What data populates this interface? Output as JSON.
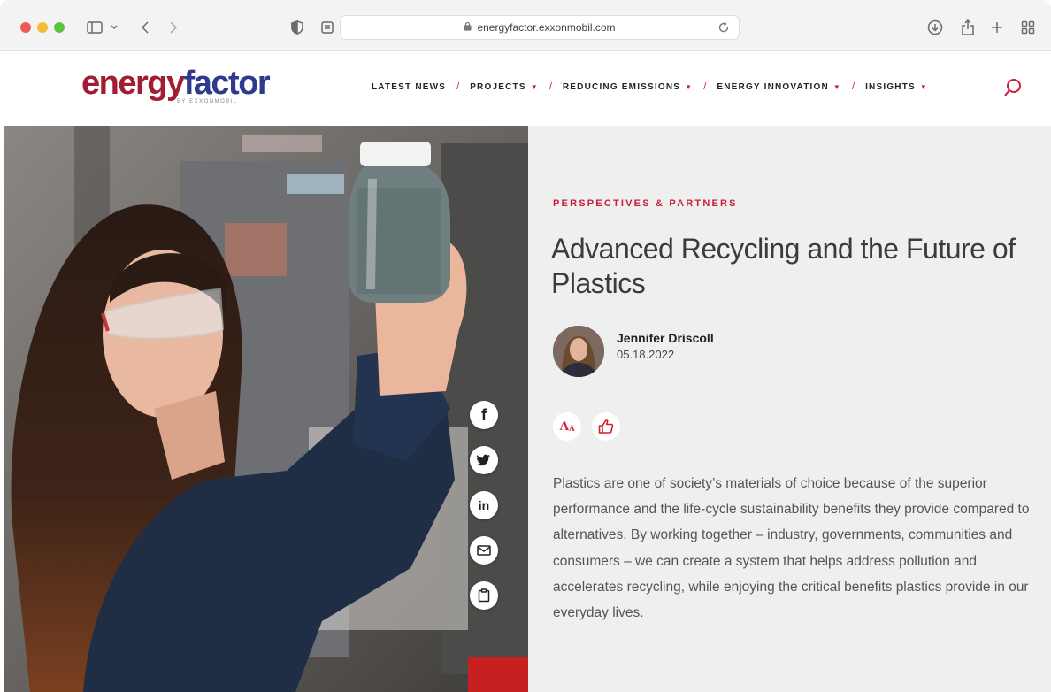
{
  "browser": {
    "url": "energyfactor.exxonmobil.com"
  },
  "site": {
    "logo_word_1": "energy",
    "logo_word_2": "factor",
    "logo_subtitle": "BY EXXONMOBIL",
    "nav": [
      {
        "label": "LATEST NEWS",
        "has_dropdown": false
      },
      {
        "label": "PROJECTS",
        "has_dropdown": true
      },
      {
        "label": "REDUCING EMISSIONS",
        "has_dropdown": true
      },
      {
        "label": "ENERGY INNOVATION",
        "has_dropdown": true
      },
      {
        "label": "INSIGHTS",
        "has_dropdown": true
      }
    ],
    "nav_separator": "/",
    "nav_caret": "▼"
  },
  "article": {
    "category": "PERSPECTIVES & PARTNERS",
    "title": "Advanced Recycling and the Future of Plastics",
    "author": "Jennifer Driscoll",
    "date": "05.18.2022",
    "body": "Plastics are one of society’s materials of choice because of the superior performance and the life-cycle sustainability benefits they provide compared to alternatives. By working together – industry, governments, communities and consumers – we can create a system that helps address pollution and accelerates recycling, while enjoying the critical benefits plastics provide in our everyday lives."
  },
  "share": [
    "facebook-icon",
    "twitter-icon",
    "linkedin-icon",
    "email-icon",
    "clipboard-icon"
  ],
  "tools": [
    "text-size-icon",
    "thumbs-up-icon"
  ],
  "colors": {
    "accent_red": "#c8203a",
    "logo_red": "#a11d33",
    "logo_blue": "#2e3a8a",
    "panel_bg": "#efefef"
  }
}
